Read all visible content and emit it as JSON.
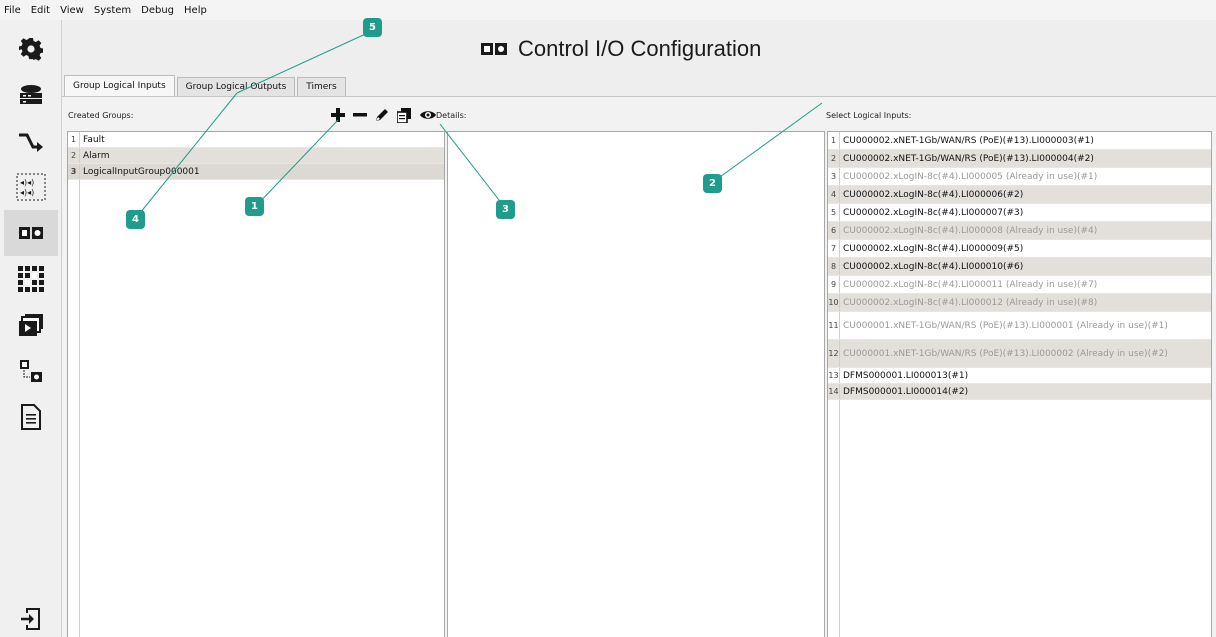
{
  "menu": [
    "File",
    "Edit",
    "View",
    "System",
    "Debug",
    "Help"
  ],
  "sidebar": [
    {
      "name": "settings-gear-icon",
      "active": false
    },
    {
      "name": "network-router-icon",
      "active": false
    },
    {
      "name": "routing-arrow-icon",
      "active": false
    },
    {
      "name": "audio-io-icon",
      "active": false
    },
    {
      "name": "control-io-icon",
      "active": true
    },
    {
      "name": "grid-matrix-icon",
      "active": false
    },
    {
      "name": "media-windows-icon",
      "active": false
    },
    {
      "name": "io-mapping-icon",
      "active": false
    },
    {
      "name": "document-icon",
      "active": false
    },
    {
      "name": "logout-icon",
      "active": false
    }
  ],
  "header": {
    "title": "Control I/O Configuration",
    "icon": "control-io-icon"
  },
  "tabs": [
    {
      "label": "Group Logical Inputs",
      "active": true
    },
    {
      "label": "Group Logical Outputs",
      "active": false
    },
    {
      "label": "Timers",
      "active": false
    }
  ],
  "labels": {
    "created_groups": "Created Groups:",
    "details": "Details:",
    "select_inputs": "Select Logical Inputs:"
  },
  "toolbar": [
    "add-icon",
    "remove-icon",
    "edit-brush-icon",
    "copy-icon",
    "view-eye-icon"
  ],
  "groups": [
    {
      "num": "1",
      "name": "Fault",
      "bold": false
    },
    {
      "num": "2",
      "name": "Alarm",
      "bold": false
    },
    {
      "num": "3",
      "name": "LogicalInputGroup000001",
      "bold": true
    }
  ],
  "inputs": [
    {
      "num": "1",
      "text": "CU000002.xNET-1Gb/WAN/RS (PoE)(#13).LI000003(#1)",
      "used": false
    },
    {
      "num": "2",
      "text": "CU000002.xNET-1Gb/WAN/RS (PoE)(#13).LI000004(#2)",
      "used": false
    },
    {
      "num": "3",
      "text": "CU000002.xLogIN-8c(#4).LI000005 (Already in use)(#1)",
      "used": true
    },
    {
      "num": "4",
      "text": "CU000002.xLogIN-8c(#4).LI000006(#2)",
      "used": false
    },
    {
      "num": "5",
      "text": "CU000002.xLogIN-8c(#4).LI000007(#3)",
      "used": false
    },
    {
      "num": "6",
      "text": "CU000002.xLogIN-8c(#4).LI000008 (Already in use)(#4)",
      "used": true
    },
    {
      "num": "7",
      "text": "CU000002.xLogIN-8c(#4).LI000009(#5)",
      "used": false
    },
    {
      "num": "8",
      "text": "CU000002.xLogIN-8c(#4).LI000010(#6)",
      "used": false
    },
    {
      "num": "9",
      "text": "CU000002.xLogIN-8c(#4).LI000011 (Already in use)(#7)",
      "used": true
    },
    {
      "num": "10",
      "text": "CU000002.xLogIN-8c(#4).LI000012 (Already in use)(#8)",
      "used": true
    },
    {
      "num": "11",
      "text": "CU000001.xNET-1Gb/WAN/RS (PoE)(#13).LI000001 (Already in use)(#1)",
      "used": true
    },
    {
      "num": "12",
      "text": "CU000001.xNET-1Gb/WAN/RS (PoE)(#13).LI000002 (Already in use)(#2)",
      "used": true
    },
    {
      "num": "13",
      "text": "DFMS000001.LI000013(#1)",
      "used": false
    },
    {
      "num": "14",
      "text": "DFMS000001.LI000014(#2)",
      "used": false
    }
  ],
  "callouts": [
    "1",
    "2",
    "3",
    "4",
    "5"
  ],
  "colors": {
    "callout": "#1f9c8b",
    "active_sidebar": "#d9d9d9",
    "row_alt": "#e3dfdb"
  }
}
